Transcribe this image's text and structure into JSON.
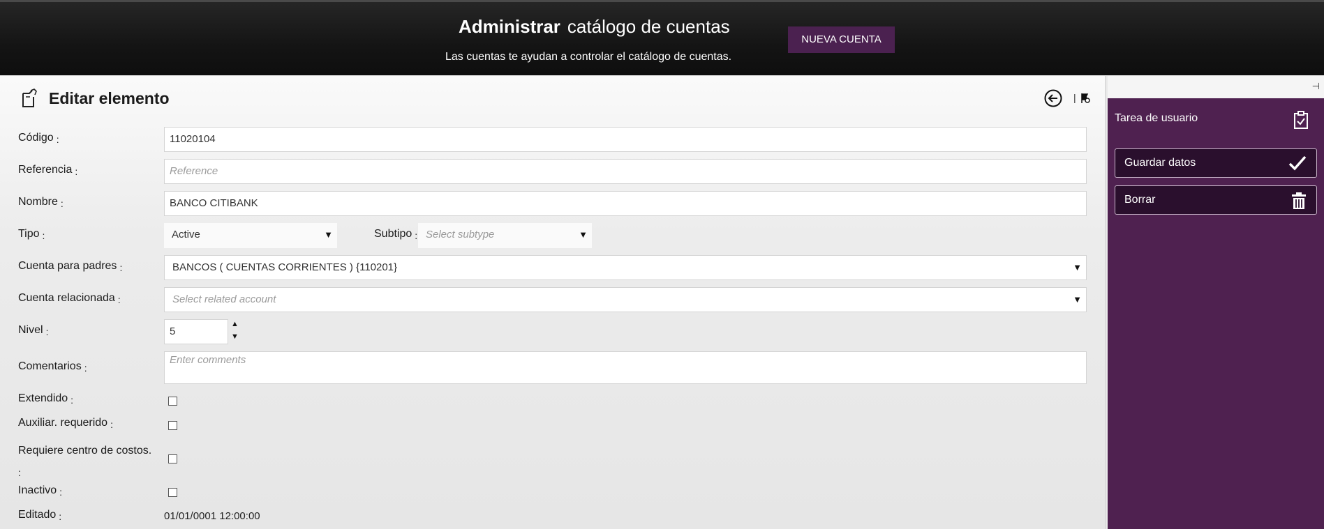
{
  "header": {
    "title_bold": "Administrar",
    "title_rest": "catálogo de cuentas",
    "subtitle": "Las cuentas te ayudan a controlar el catálogo de cuentas.",
    "new_button": "NUEVA CUENTA"
  },
  "form": {
    "title": "Editar elemento",
    "separator": "|",
    "colon": ":",
    "codigo": {
      "label": "Código",
      "value": "11020104"
    },
    "referencia": {
      "label": "Referencia",
      "placeholder": "Reference"
    },
    "nombre": {
      "label": "Nombre",
      "value": "BANCO CITIBANK"
    },
    "tipo": {
      "label": "Tipo",
      "value": "Active"
    },
    "subtipo": {
      "label": "Subtipo",
      "placeholder": "Select subtype"
    },
    "cuenta_padres": {
      "label": "Cuenta para padres",
      "value": "BANCOS ( CUENTAS CORRIENTES ) {110201}"
    },
    "cuenta_relacionada": {
      "label": "Cuenta relacionada",
      "placeholder": "Select related account"
    },
    "nivel": {
      "label": "Nivel",
      "value": "5"
    },
    "comentarios": {
      "label": "Comentarios",
      "placeholder": "Enter comments"
    },
    "extendido": {
      "label": "Extendido",
      "checked": false
    },
    "auxiliar": {
      "label": "Auxiliar. requerido",
      "checked": false
    },
    "centro_costos": {
      "label": "Requiere centro de costos.",
      "checked": false
    },
    "inactivo": {
      "label": "Inactivo",
      "checked": false
    },
    "editado": {
      "label": "Editado",
      "value": "01/01/0001 12:00:00"
    }
  },
  "sidebar": {
    "pin_glyph": "⊣",
    "task_label": "Tarea de usuario",
    "save_button": "Guardar datos",
    "delete_button": "Borrar"
  },
  "icons": {
    "edit": "edit-document-icon",
    "back": "back-arrow-icon",
    "pin": "pin-icon",
    "task": "clipboard-check-icon",
    "save": "checkmark-icon",
    "delete": "trash-icon"
  },
  "colors": {
    "header_bg": "#141414",
    "accent_purple": "#4f2150",
    "button_purple": "#4b2150",
    "side_button_bg": "#2a0f2d"
  }
}
